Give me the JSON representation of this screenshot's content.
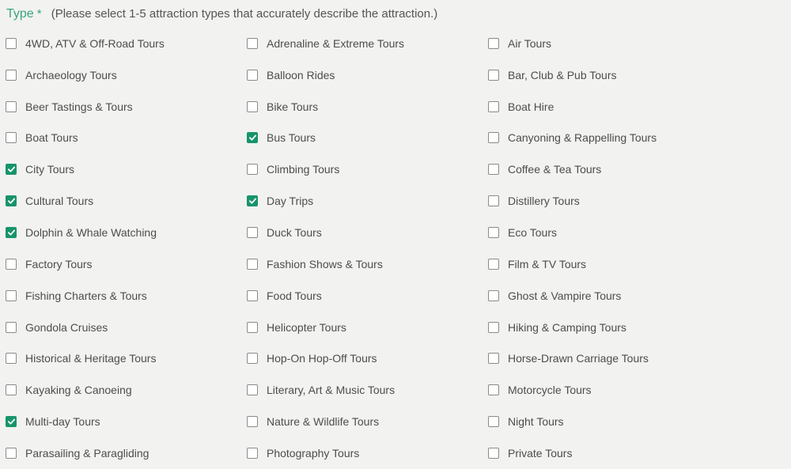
{
  "header": {
    "title": "Type",
    "required_marker": "*",
    "hint": "(Please select 1-5 attraction types that accurately describe the attraction.)"
  },
  "colors": {
    "accent": "#17946b",
    "title": "#3aa57e"
  },
  "options": [
    {
      "label": "4WD, ATV & Off-Road Tours",
      "checked": false
    },
    {
      "label": "Adrenaline & Extreme Tours",
      "checked": false
    },
    {
      "label": "Air Tours",
      "checked": false
    },
    {
      "label": "Archaeology Tours",
      "checked": false
    },
    {
      "label": "Balloon Rides",
      "checked": false
    },
    {
      "label": "Bar, Club & Pub Tours",
      "checked": false
    },
    {
      "label": "Beer Tastings & Tours",
      "checked": false
    },
    {
      "label": "Bike Tours",
      "checked": false
    },
    {
      "label": "Boat Hire",
      "checked": false
    },
    {
      "label": "Boat Tours",
      "checked": false
    },
    {
      "label": "Bus Tours",
      "checked": true
    },
    {
      "label": "Canyoning & Rappelling Tours",
      "checked": false
    },
    {
      "label": "City Tours",
      "checked": true
    },
    {
      "label": "Climbing Tours",
      "checked": false
    },
    {
      "label": "Coffee & Tea Tours",
      "checked": false
    },
    {
      "label": "Cultural Tours",
      "checked": true
    },
    {
      "label": "Day Trips",
      "checked": true
    },
    {
      "label": "Distillery Tours",
      "checked": false
    },
    {
      "label": "Dolphin & Whale Watching",
      "checked": true
    },
    {
      "label": "Duck Tours",
      "checked": false
    },
    {
      "label": "Eco Tours",
      "checked": false
    },
    {
      "label": "Factory Tours",
      "checked": false
    },
    {
      "label": "Fashion Shows & Tours",
      "checked": false
    },
    {
      "label": "Film & TV Tours",
      "checked": false
    },
    {
      "label": "Fishing Charters & Tours",
      "checked": false
    },
    {
      "label": "Food Tours",
      "checked": false
    },
    {
      "label": "Ghost & Vampire Tours",
      "checked": false
    },
    {
      "label": "Gondola Cruises",
      "checked": false
    },
    {
      "label": "Helicopter Tours",
      "checked": false
    },
    {
      "label": "Hiking & Camping Tours",
      "checked": false
    },
    {
      "label": "Historical & Heritage Tours",
      "checked": false
    },
    {
      "label": "Hop-On Hop-Off Tours",
      "checked": false
    },
    {
      "label": "Horse-Drawn Carriage Tours",
      "checked": false
    },
    {
      "label": "Kayaking & Canoeing",
      "checked": false
    },
    {
      "label": "Literary, Art & Music Tours",
      "checked": false
    },
    {
      "label": "Motorcycle Tours",
      "checked": false
    },
    {
      "label": "Multi-day Tours",
      "checked": true
    },
    {
      "label": "Nature & Wildlife Tours",
      "checked": false
    },
    {
      "label": "Night Tours",
      "checked": false
    },
    {
      "label": "Parasailing & Paragliding",
      "checked": false
    },
    {
      "label": "Photography Tours",
      "checked": false
    },
    {
      "label": "Private Tours",
      "checked": false
    }
  ]
}
